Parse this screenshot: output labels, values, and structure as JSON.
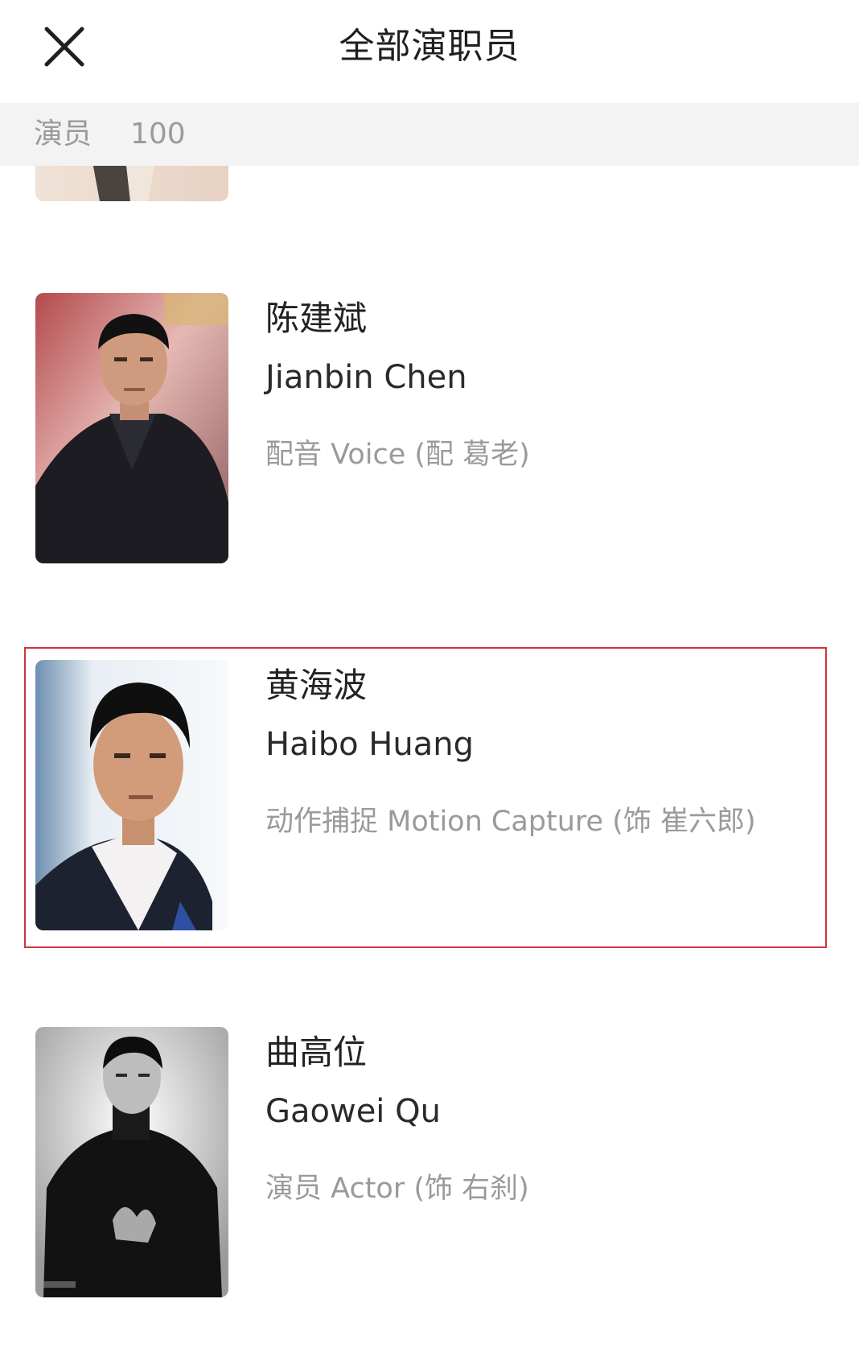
{
  "header": {
    "title": "全部演职员",
    "close_icon": "close-icon"
  },
  "section": {
    "label": "演员",
    "count": "100"
  },
  "cast": [
    {
      "name_cn": "陈建斌",
      "name_en": "Jianbin Chen",
      "role": "配音 Voice (配 葛老)",
      "highlighted": false
    },
    {
      "name_cn": "黄海波",
      "name_en": "Haibo Huang",
      "role": "动作捕捉 Motion Capture (饰 崔六郎)",
      "highlighted": true
    },
    {
      "name_cn": "曲高位",
      "name_en": "Gaowei Qu",
      "role": "演员 Actor (饰 右刹)",
      "highlighted": false
    }
  ],
  "colors": {
    "highlight_border": "#d2343c",
    "section_bg": "#f3f3f3",
    "secondary_text": "#9a9a9a"
  }
}
